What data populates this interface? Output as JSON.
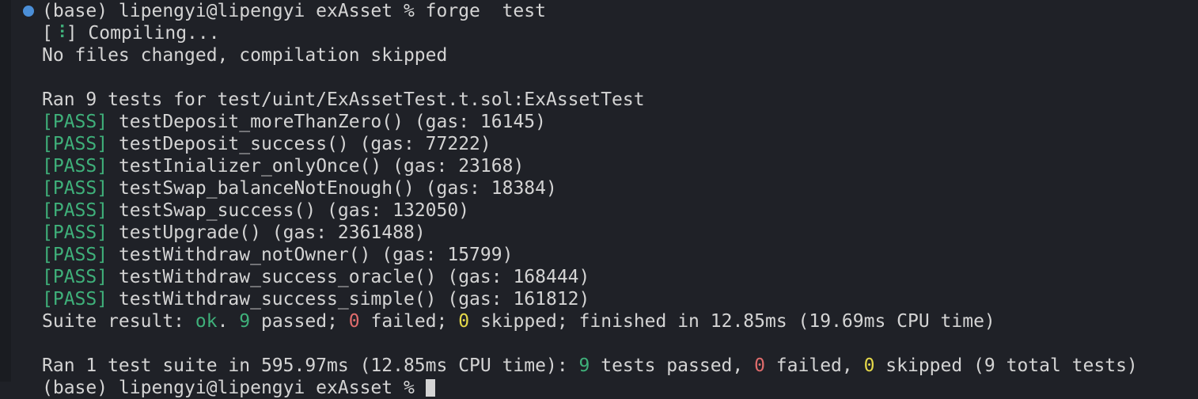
{
  "terminal": {
    "prompt_line": "(base) lipengyi@lipengyi exAsset % forge  test",
    "compiling_open": "[",
    "spinner_glyph": "⠸",
    "compiling_rest": "] Compiling...",
    "no_change": "No files changed, compilation skipped",
    "ran_header": "Ran 9 tests for test/uint/ExAssetTest.t.sol:ExAssetTest",
    "pass_tag": "[PASS]",
    "tests": [
      " testDeposit_moreThanZero() (gas: 16145)",
      " testDeposit_success() (gas: 77222)",
      " testInializer_onlyOnce() (gas: 23168)",
      " testSwap_balanceNotEnough() (gas: 18384)",
      " testSwap_success() (gas: 132050)",
      " testUpgrade() (gas: 2361488)",
      " testWithdraw_notOwner() (gas: 15799)",
      " testWithdraw_success_oracle() (gas: 168444)",
      " testWithdraw_success_simple() (gas: 161812)"
    ],
    "suite": {
      "prefix": "Suite result: ",
      "ok": "ok",
      "dot": ". ",
      "passed_n": "9",
      "passed_text": " passed; ",
      "failed_n": "0",
      "failed_text": " failed; ",
      "skipped_n": "0",
      "skipped_text": " skipped; finished in 12.85ms (19.69ms CPU time)"
    },
    "summary": {
      "prefix": "Ran 1 test suite in 595.97ms (12.85ms CPU time): ",
      "passed_n": "9",
      "passed_text": " tests passed, ",
      "failed_n": "0",
      "failed_text": " failed, ",
      "skipped_n": "0",
      "skipped_text": " skipped (9 total tests)"
    },
    "last_prompt": "(base) lipengyi@lipengyi exAsset % "
  },
  "colors": {
    "background": "#1f2127",
    "text": "#d4d4d4",
    "pass": "#3fb07a",
    "fail": "#e06c6c",
    "skip": "#e5d94a",
    "prompt_dot": "#4b8fd8"
  }
}
